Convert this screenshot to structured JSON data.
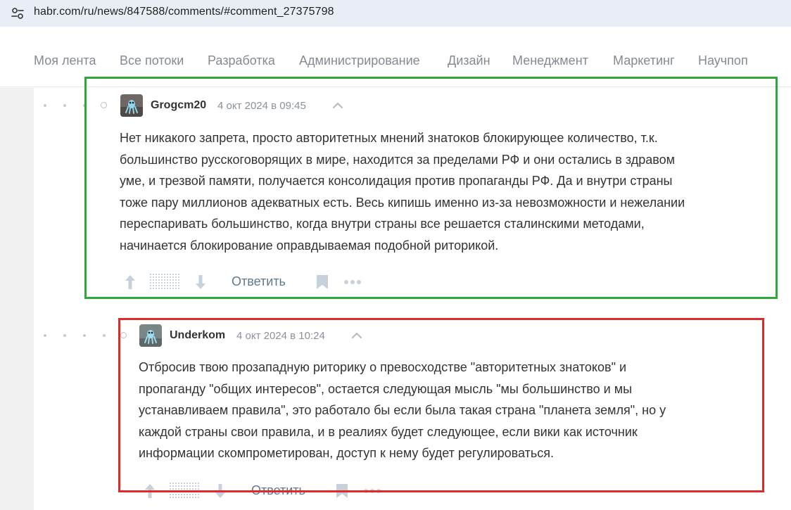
{
  "browser": {
    "url": "habr.com/ru/news/847588/comments/#comment_27375798"
  },
  "nav": {
    "items": [
      "Моя лента",
      "Все потоки",
      "Разработка",
      "Администрирование",
      "Дизайн",
      "Менеджмент",
      "Маркетинг",
      "Научпоп"
    ]
  },
  "comments": [
    {
      "author": "Grogcm20",
      "time": "4 окт 2024 в 09:45",
      "lines": [
        "Нет никакого запрета, просто авторитетных мнений знатоков блокирующее количество, т.к.",
        "большинство русскоговорящих в мире, находится за пределами РФ и они остались в здравом",
        "уме, и трезвой памяти, получается консолидация против пропаганды РФ. Да и внутри страны",
        "тоже пару миллионов адекватных есть. Весь кипишь именно из-за невозможности и нежелании",
        "переспаривать большинство, когда внутри страны все решается сталинскими методами,",
        "начинается блокирование оправдываемая подобной риторикой."
      ],
      "reply_label": "Ответить",
      "frame_color": "#2ea83a"
    },
    {
      "author": "Underkom",
      "time": "4 окт 2024 в 10:24",
      "lines": [
        "Отбросив твою прозападную риторику о превосходстве \"авторитетных знатоков\" и",
        "пропаганду \"общих интересов\", остается следующая мысль \"мы большинство и мы",
        "устанавливаем правила\", это работало бы если была такая страна \"планета земля\", но у",
        "каждой страны свои правила, и в реалиях будет следующее, если вики как источник",
        "информации скомпрометирован, доступ к нему будет регулироваться."
      ],
      "reply_label": "Ответить",
      "frame_color": "#dd2a2a"
    }
  ],
  "icons": {
    "site_info": "tune-icon",
    "upvote": "arrow-up-icon",
    "downvote": "arrow-down-icon",
    "bookmark": "bookmark-icon",
    "more": "more-icon",
    "collapse": "chevron-up-icon"
  }
}
